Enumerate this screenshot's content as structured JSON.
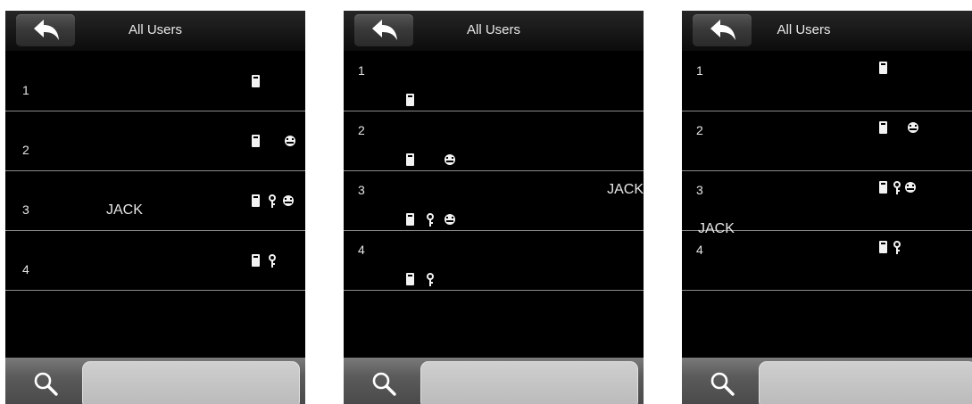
{
  "screens": [
    {
      "title": "All Users",
      "layout": "single-line",
      "users": [
        {
          "id": "1",
          "name": "",
          "card": true,
          "password": false,
          "face": false
        },
        {
          "id": "2",
          "name": "",
          "card": true,
          "password": false,
          "face": true
        },
        {
          "id": "3",
          "name": "JACK",
          "card": true,
          "password": true,
          "face": true
        },
        {
          "id": "4",
          "name": "",
          "card": true,
          "password": true,
          "face": false
        }
      ]
    },
    {
      "title": "All Users",
      "layout": "two-line-name-right",
      "users": [
        {
          "id": "1",
          "name": "",
          "card": true,
          "password": false,
          "face": false
        },
        {
          "id": "2",
          "name": "",
          "card": true,
          "password": false,
          "face": true
        },
        {
          "id": "3",
          "name": "JACK",
          "card": true,
          "password": true,
          "face": true
        },
        {
          "id": "4",
          "name": "",
          "card": true,
          "password": true,
          "face": false
        }
      ]
    },
    {
      "title": "All Users",
      "layout": "two-line-name-below",
      "users": [
        {
          "id": "1",
          "name": "",
          "card": true,
          "password": false,
          "face": false
        },
        {
          "id": "2",
          "name": "",
          "card": true,
          "password": false,
          "face": true
        },
        {
          "id": "3",
          "name": "JACK",
          "card": true,
          "password": true,
          "face": true
        },
        {
          "id": "4",
          "name": "",
          "card": true,
          "password": true,
          "face": false
        }
      ]
    }
  ],
  "icons": {
    "back": "back-arrow-icon",
    "search": "magnifier-icon",
    "card": "card-icon",
    "password": "key-icon",
    "face": "face-icon"
  }
}
